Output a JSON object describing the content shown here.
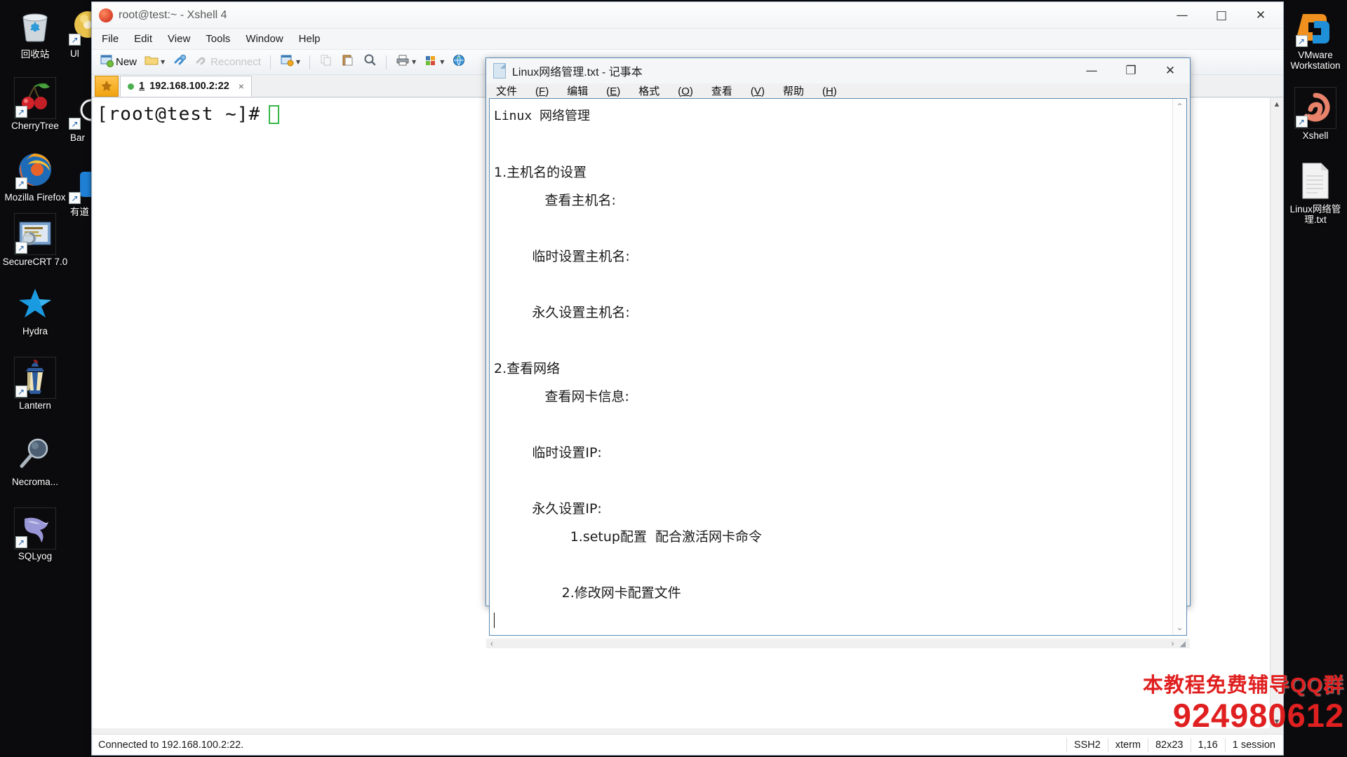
{
  "desktop": {
    "icons_left_col1": [
      {
        "label": "回收站",
        "icon": "recycle-bin-icon",
        "shortcut": false
      },
      {
        "label": "CherryTree",
        "icon": "cherrytree-icon",
        "shortcut": true
      },
      {
        "label": "Mozilla Firefox",
        "icon": "firefox-icon",
        "shortcut": true
      },
      {
        "label": "SecureCRT 7.0",
        "icon": "securecrt-icon",
        "shortcut": true
      },
      {
        "label": "Hydra",
        "icon": "hydra-star-icon",
        "shortcut": false
      },
      {
        "label": "Lantern",
        "icon": "lantern-icon",
        "shortcut": true
      },
      {
        "label": "Necroma...",
        "icon": "magnifier-icon",
        "shortcut": false
      },
      {
        "label": "SQLyog",
        "icon": "sqlyog-dolphin-icon",
        "shortcut": true
      }
    ],
    "icons_left_col2": [
      {
        "label": "Ul",
        "icon": "ultraiso-icon",
        "shortcut": true
      },
      {
        "label": "Bar",
        "icon": "baidu-icon",
        "shortcut": true
      },
      {
        "label": "有道",
        "icon": "youdao-icon",
        "shortcut": true
      }
    ],
    "icons_right": [
      {
        "label": "VMware Workstation",
        "icon": "vmware-icon",
        "shortcut": true
      },
      {
        "label": "Xshell",
        "icon": "xshell-icon",
        "shortcut": true
      },
      {
        "label": "Linux网络管理.txt",
        "icon": "text-file-icon",
        "shortcut": false
      }
    ]
  },
  "xshell": {
    "title": "root@test:~ - Xshell 4",
    "window_buttons": {
      "minimize": "—",
      "maximize": "□",
      "close": "✕"
    },
    "menu": [
      "File",
      "Edit",
      "View",
      "Tools",
      "Window",
      "Help"
    ],
    "toolbar": {
      "new_label": "New",
      "reconnect_label": "Reconnect",
      "items": [
        "new-session-icon",
        "open-folder-icon",
        "open-dropdown-caret",
        "connect-icon",
        "reconnect-icon",
        "sessions-icon",
        "sessions-caret",
        "copy-icon",
        "paste-icon",
        "find-icon",
        "print-icon",
        "print-caret",
        "transfer-icon",
        "transfer-caret",
        "globe-icon"
      ]
    },
    "tab": {
      "number": "1",
      "address": "192.168.100.2:22",
      "close": "×",
      "launcher_icon": "session-launcher-icon"
    },
    "terminal": {
      "prompt": "[root@test ~]#"
    },
    "statusbar": {
      "left": "Connected to 192.168.100.2:22.",
      "cells": [
        "SSH2",
        "xterm",
        "82x23",
        "1,16",
        "1 session"
      ]
    }
  },
  "notepad": {
    "title": "Linux网络管理.txt - 记事本",
    "doc_icon": "text-document-icon",
    "window_buttons": {
      "minimize": "—",
      "maximize": "❐",
      "close": "✕"
    },
    "menu": [
      {
        "label": "文件",
        "accel": "F"
      },
      {
        "label": "编辑",
        "accel": "E"
      },
      {
        "label": "格式",
        "accel": "O"
      },
      {
        "label": "查看",
        "accel": "V"
      },
      {
        "label": "帮助",
        "accel": "H"
      }
    ],
    "content_lines": [
      "Linux 网络管理",
      "",
      "1.主机名的设置",
      "            查看主机名:",
      "",
      "         临时设置主机名:",
      "",
      "         永久设置主机名:",
      "",
      "2.查看网络",
      "            查看网卡信息:",
      "",
      "         临时设置IP:",
      "",
      "         永久设置IP:",
      "                  1.setup配置  配合激活网卡命令",
      "",
      "                2.修改网卡配置文件"
    ],
    "scroll": {
      "up_arrow": "⌃",
      "down_arrow": "⌄",
      "left_arrow": "‹",
      "right_arrow": "›",
      "grip": "◢"
    }
  },
  "watermark": {
    "line1": "本教程免费辅导QQ群",
    "line2": "924980612",
    "color": "#e02020"
  }
}
